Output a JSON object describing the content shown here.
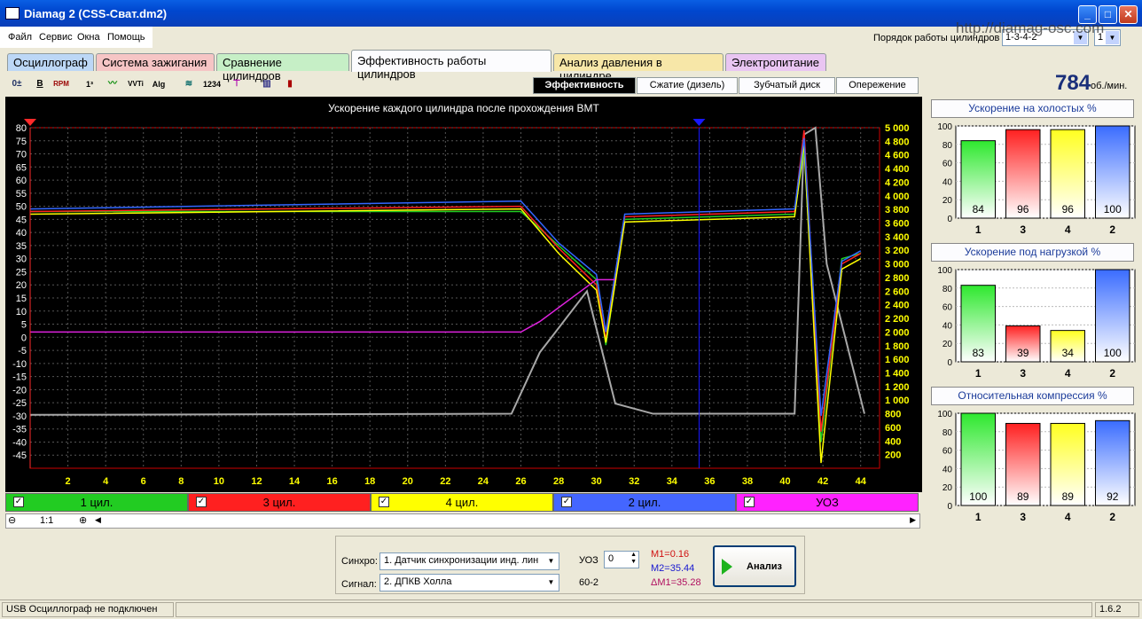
{
  "window": {
    "title": "Diamag 2 (CSS-Сват.dm2)",
    "watermark": "http://diamag-osc.com"
  },
  "menu": [
    "Файл",
    "Сервис",
    "Окна",
    "Помощь"
  ],
  "order": {
    "label": "Порядок работы цилиндров",
    "value": "1-3-4-2",
    "value2": "1"
  },
  "tabs": [
    {
      "label": "Осциллограф",
      "color": "#bcd7f6"
    },
    {
      "label": "Система зажигания",
      "color": "#f6c5c5"
    },
    {
      "label": "Сравнение цилиндров",
      "color": "#c6efc6"
    },
    {
      "label": "Эффективность работы цилиндров",
      "color": "#fcfcfe"
    },
    {
      "label": "Анализ давления в цилиндре",
      "color": "#f7e7a8"
    },
    {
      "label": "Электропитание",
      "color": "#e9c5f2"
    }
  ],
  "subtabs": [
    "Эффективность",
    "Сжатие (дизель)",
    "Зубчатый диск",
    "Опережение"
  ],
  "rpm": {
    "value": "784",
    "unit": "об./мин."
  },
  "chart_data": {
    "type": "line",
    "title": "Ускорение каждого цилиндра после прохождения ВМТ",
    "xlim": [
      0,
      45
    ],
    "x_ticks": [
      2,
      4,
      6,
      8,
      10,
      12,
      14,
      16,
      18,
      20,
      22,
      24,
      26,
      28,
      30,
      32,
      34,
      36,
      38,
      40,
      42,
      44
    ],
    "ylim": [
      -50,
      80
    ],
    "y_ticks": [
      80,
      75,
      70,
      65,
      60,
      55,
      50,
      45,
      40,
      35,
      30,
      25,
      20,
      15,
      10,
      5,
      0,
      -5,
      -10,
      -15,
      -20,
      -25,
      -30,
      -35,
      -40,
      -45
    ],
    "y2lim": [
      0,
      5000
    ],
    "y2_ticks": [
      "5 000",
      "4 800",
      "4 600",
      "4 400",
      "4 200",
      "4 000",
      "3 800",
      "3 600",
      "3 400",
      "3 200",
      "3 000",
      "2 800",
      "2 600",
      "2 400",
      "2 200",
      "2 000",
      "1 800",
      "1 600",
      "1 400",
      "1 200",
      "1 000",
      "800",
      "600",
      "400",
      "200"
    ],
    "grid": true,
    "series": [
      {
        "name": "1 цил.",
        "color": "#22cc22",
        "x": [
          0,
          26,
          28,
          30,
          30.5,
          31.5,
          40.5,
          41,
          41.9,
          43,
          44
        ],
        "y": [
          48,
          48,
          35,
          22,
          -3,
          45,
          47,
          72,
          -40,
          30,
          32
        ]
      },
      {
        "name": "3 цил.",
        "color": "#ff2020",
        "x": [
          0,
          26,
          28,
          30,
          30.5,
          31.5,
          40.5,
          41,
          41.9,
          43,
          44
        ],
        "y": [
          48,
          50,
          34,
          20,
          -1,
          46,
          48,
          79,
          -36,
          28,
          32
        ]
      },
      {
        "name": "4 цил.",
        "color": "#ffff00",
        "x": [
          0,
          26,
          28,
          30,
          30.5,
          31.5,
          40.5,
          41,
          41.9,
          43,
          44
        ],
        "y": [
          47,
          49,
          32,
          18,
          -2,
          44,
          46,
          74,
          -48,
          26,
          30
        ]
      },
      {
        "name": "2 цил.",
        "color": "#3366ff",
        "x": [
          0,
          26,
          28,
          30,
          30.5,
          31.5,
          40.5,
          41,
          41.9,
          43,
          44
        ],
        "y": [
          49,
          52,
          36,
          24,
          2,
          47,
          49,
          76,
          -30,
          29,
          33
        ]
      },
      {
        "name": "УОЗ",
        "color": "#dd22dd",
        "x": [
          0,
          26,
          27,
          30,
          31
        ],
        "y": [
          2,
          2,
          6,
          22,
          22
        ]
      }
    ],
    "rpm_trace": {
      "color": "#a8a8a8",
      "x": [
        0,
        25.5,
        27,
        29.5,
        31,
        33,
        40.5,
        41,
        41.6,
        42.2,
        44.2
      ],
      "y": [
        784,
        800,
        1700,
        2600,
        950,
        800,
        800,
        4900,
        5000,
        3000,
        800
      ]
    },
    "cursors": [
      {
        "x": 0,
        "color": "#ff2a2a"
      },
      {
        "x": 35.44,
        "color": "#1818ff"
      }
    ]
  },
  "legend": [
    {
      "label": "1 цил.",
      "color": "#22cc22"
    },
    {
      "label": "3 цил.",
      "color": "#ff2020"
    },
    {
      "label": "4 цил.",
      "color": "#ffff00"
    },
    {
      "label": "2 цил.",
      "color": "#4466ff"
    },
    {
      "label": "УОЗ",
      "color": "#ff22ff"
    }
  ],
  "zoom": "1:1",
  "side_charts": [
    {
      "title": "Ускорение на холостых %",
      "categories": [
        "1",
        "3",
        "4",
        "2"
      ],
      "values": [
        84,
        96,
        96,
        100
      ],
      "colors": [
        "#2ee82e",
        "#ff2020",
        "#ffff20",
        "#3a6cff"
      ],
      "ylim": [
        0,
        100
      ]
    },
    {
      "title": "Ускорение под нагрузкой %",
      "categories": [
        "1",
        "3",
        "4",
        "2"
      ],
      "values": [
        83,
        39,
        34,
        100
      ],
      "colors": [
        "#2ee82e",
        "#ff2020",
        "#ffff20",
        "#3a6cff"
      ],
      "ylim": [
        0,
        100
      ]
    },
    {
      "title": "Относительная компрессия %",
      "categories": [
        "1",
        "3",
        "4",
        "2"
      ],
      "values": [
        100,
        89,
        89,
        92
      ],
      "colors": [
        "#2ee82e",
        "#ff2020",
        "#ffff20",
        "#3a6cff"
      ],
      "ylim": [
        0,
        100
      ]
    }
  ],
  "bottom": {
    "sync_label": "Синхро:",
    "sync_value": "1. Датчик синхронизации инд. лин",
    "signal_label": "Сигнал:",
    "signal_value": "2. ДПКВ Холла",
    "uoz_label": "УОЗ",
    "uoz_value": "0",
    "teeth": "60-2",
    "m1": "M1=0.16",
    "m2": "M2=35.44",
    "dm": "ΔM1=35.28",
    "analyze": "Анализ"
  },
  "status": {
    "text": "USB Осциллограф не подключен",
    "version": "1.6.2"
  }
}
